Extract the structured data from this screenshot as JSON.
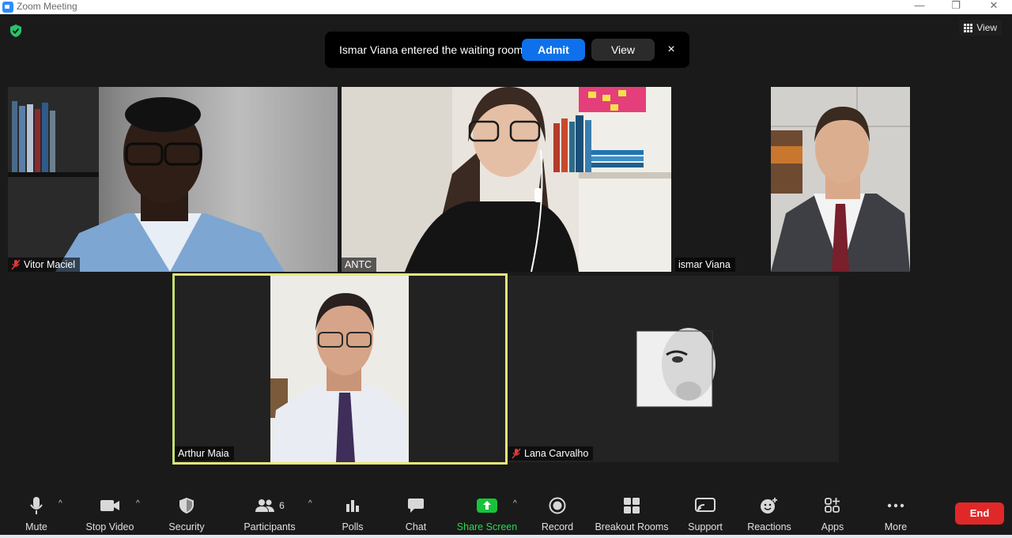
{
  "window": {
    "title": "Zoom Meeting",
    "minimize": "—",
    "restore": "❐",
    "close": "✕"
  },
  "header": {
    "view_label": "View"
  },
  "notification": {
    "message": "Ismar Viana entered the waiting room",
    "admit_label": "Admit",
    "view_label": "View",
    "close_label": "×"
  },
  "participants": [
    {
      "name": "Vitor Maciel",
      "muted": true
    },
    {
      "name": "ANTC",
      "muted": false
    },
    {
      "name": "ismar Viana",
      "muted": false
    },
    {
      "name": "Arthur Maia",
      "muted": false,
      "active_speaker": true
    },
    {
      "name": "Lana Carvalho",
      "muted": true
    }
  ],
  "toolbar": {
    "mute": "Mute",
    "stop_video": "Stop Video",
    "security": "Security",
    "participants": "Participants",
    "participants_count": "6",
    "polls": "Polls",
    "chat": "Chat",
    "share_screen": "Share Screen",
    "record": "Record",
    "breakout_rooms": "Breakout Rooms",
    "support": "Support",
    "reactions": "Reactions",
    "apps": "Apps",
    "more": "More",
    "end": "End",
    "caret": "^"
  },
  "colors": {
    "accent_blue": "#0e71eb",
    "share_green": "#19c23a",
    "end_red": "#e02828",
    "active_speaker_border": "#e8e87a",
    "security_green": "#27c26b"
  }
}
